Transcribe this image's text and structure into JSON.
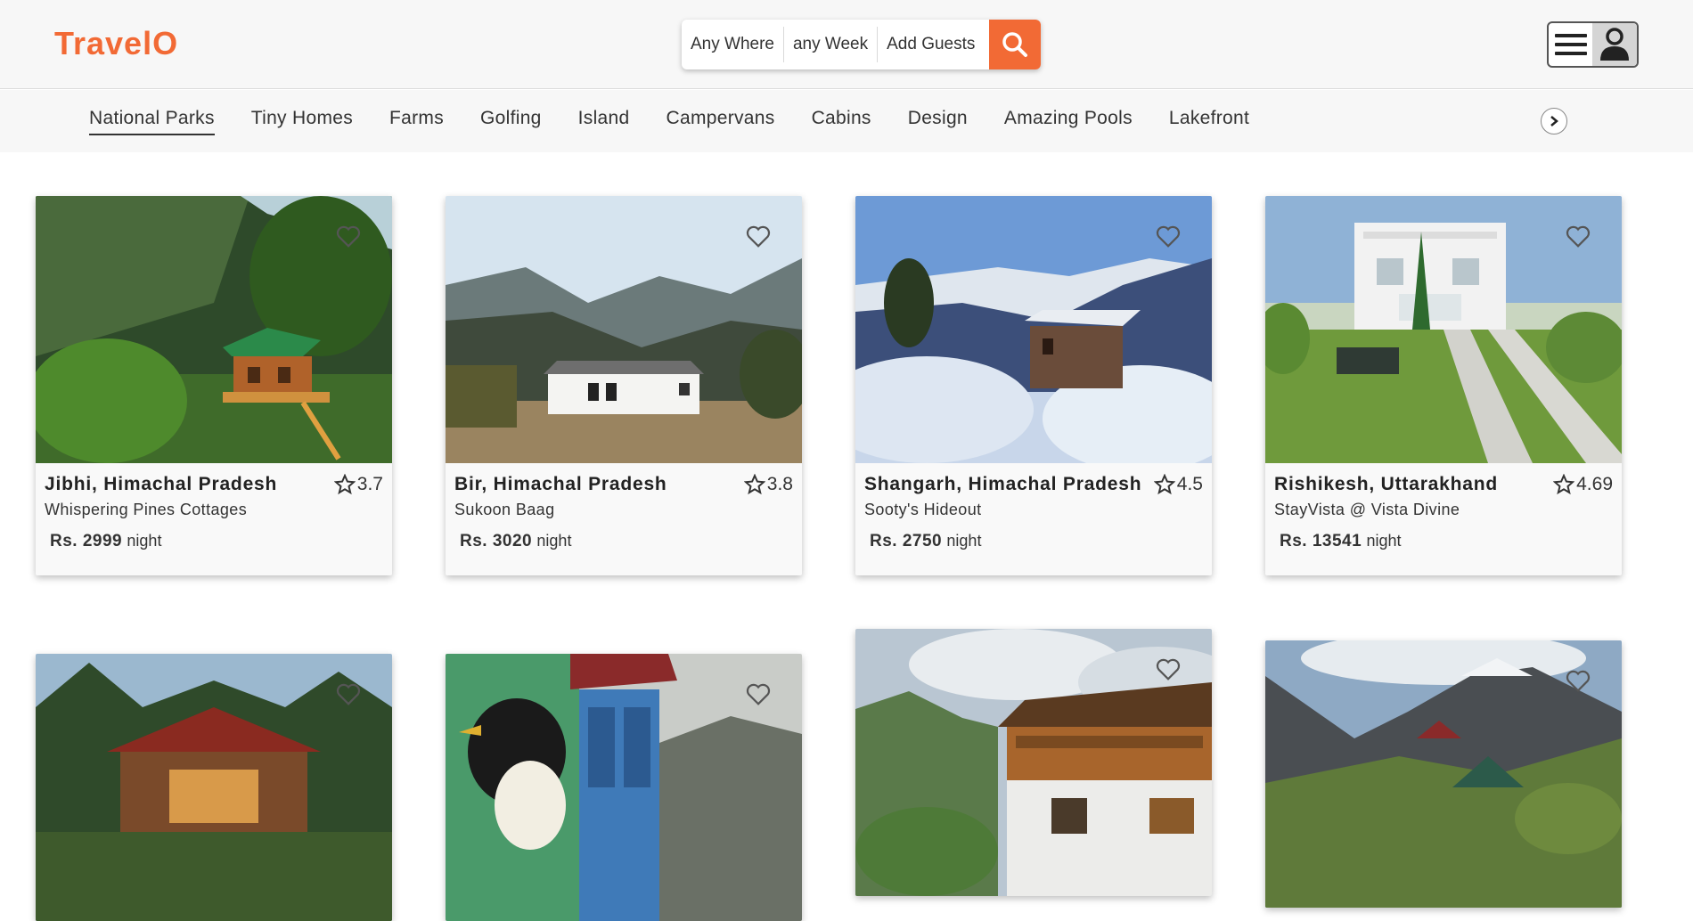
{
  "header": {
    "logo": "TravelO",
    "search": {
      "where": "Any Where",
      "when": "any Week",
      "guests": "Add Guests",
      "button_icon": "search-icon"
    },
    "user_menu": {
      "menu_icon": "hamburger-icon",
      "profile_icon": "user-icon"
    }
  },
  "categories": {
    "items": [
      "National Parks",
      "Tiny Homes",
      "Farms",
      "Golfing",
      "Island",
      "Campervans",
      "Cabins",
      "Design",
      "Amazing Pools",
      "Lakefront"
    ],
    "active": "National Parks",
    "next_icon": "chevron-right-icon"
  },
  "colors": {
    "accent": "#f26a35",
    "background": "#ffffff",
    "bar": "#f7f7f7"
  },
  "listings": [
    {
      "location": "Jibhi, Himachal Pradesh",
      "rating": "3.7",
      "name": "Whispering Pines Cottages",
      "price": "Rs. 2999",
      "unit": "night",
      "image": "treehouse-cabin-photo"
    },
    {
      "location": "Bir, Himachal Pradesh",
      "rating": "3.8",
      "name": "Sukoon Baag",
      "price": "Rs. 3020",
      "unit": "night",
      "image": "white-cottage-valley-photo"
    },
    {
      "location": "Shangarh, Himachal Pradesh",
      "rating": "4.5",
      "name": "Sooty's Hideout",
      "price": "Rs. 2750",
      "unit": "night",
      "image": "snowy-hut-photo"
    },
    {
      "location": "Rishikesh, Uttarakhand",
      "rating": "4.69",
      "name": "StayVista @ Vista Divine",
      "price": "Rs. 13541",
      "unit": "night",
      "image": "white-villa-lawn-photo"
    },
    {
      "image": "wooden-cottage-forest-photo"
    },
    {
      "image": "bird-mural-house-photo"
    },
    {
      "image": "wooden-balcony-house-photo"
    },
    {
      "image": "mountain-camping-photo"
    }
  ]
}
